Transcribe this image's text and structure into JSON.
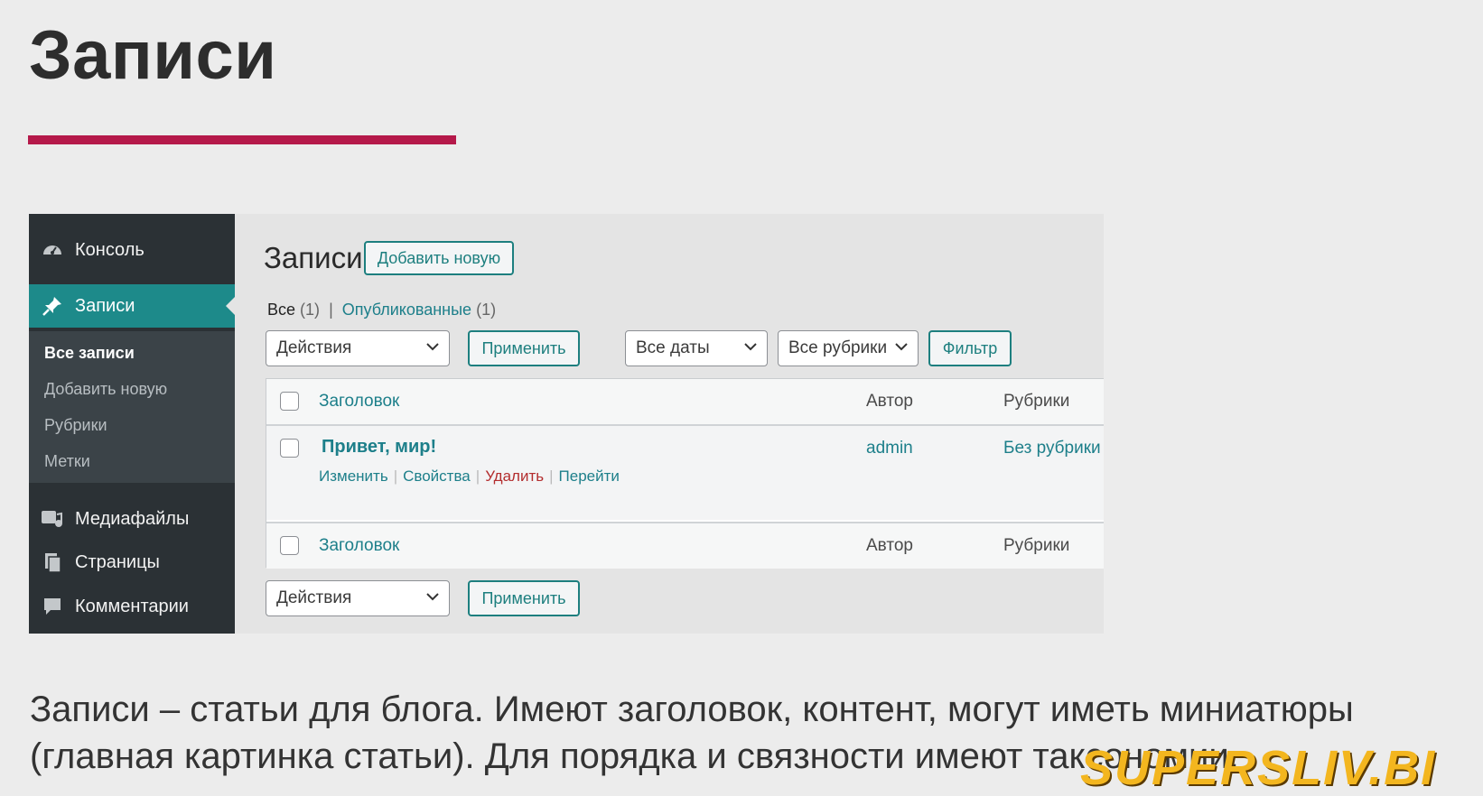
{
  "slide": {
    "title": "Записи",
    "accent_color": "#b5194a",
    "caption_line1": "Записи – статьи для блога. Имеют заголовок, контент, могут иметь миниатюры",
    "caption_line2": "(главная картинка статьи). Для порядка и связности имеют таксономии.",
    "watermark": "SUPERSLIV.BI"
  },
  "sidebar": {
    "items": [
      {
        "label": "Консоль",
        "icon": "dashboard-icon"
      },
      {
        "label": "Записи",
        "icon": "pin-icon",
        "active": true
      },
      {
        "label": "Медиафайлы",
        "icon": "media-icon"
      },
      {
        "label": "Страницы",
        "icon": "pages-icon"
      },
      {
        "label": "Комментарии",
        "icon": "comments-icon"
      }
    ],
    "submenu": [
      "Все записи",
      "Добавить новую",
      "Рубрики",
      "Метки"
    ]
  },
  "main": {
    "heading": "Записи",
    "add_new": "Добавить новую",
    "views": {
      "all_label": "Все",
      "all_count": "(1)",
      "sep": "|",
      "published_label": "Опубликованные",
      "published_count": "(1)"
    },
    "bulk_actions": "Действия",
    "apply": "Применить",
    "dates": "Все даты",
    "categories": "Все рубрики",
    "filter": "Фильтр",
    "columns": {
      "title": "Заголовок",
      "author": "Автор",
      "categories": "Рубрики"
    },
    "rows": [
      {
        "title": "Привет, мир!",
        "author": "admin",
        "category": "Без рубрики",
        "actions": {
          "edit": "Изменить",
          "quick_edit": "Свойства",
          "trash": "Удалить",
          "view": "Перейти"
        }
      }
    ]
  },
  "colors": {
    "sidebar": "#2b3135",
    "active": "#1d8a8a",
    "link": "#1d7f8a",
    "delete": "#b32d2e"
  }
}
